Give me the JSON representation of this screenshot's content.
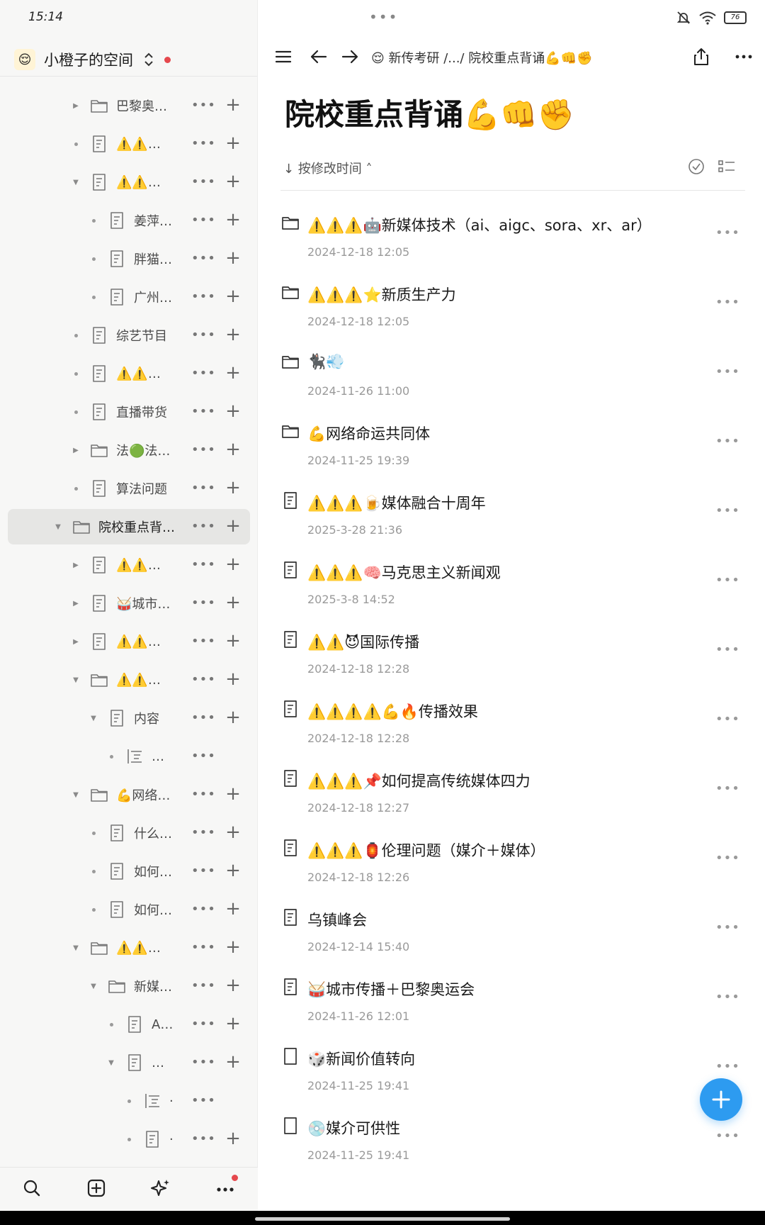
{
  "status": {
    "time": "15:14",
    "battery": "76"
  },
  "sidebar": {
    "space_emoji": "😌",
    "space_name": "小橙子的空间",
    "tree": [
      {
        "label": "巴黎奥…",
        "kind": "folder",
        "depth": 0,
        "toggle": "collapsed"
      },
      {
        "label": "⚠️⚠️…",
        "kind": "doc",
        "depth": 0,
        "toggle": "bullet"
      },
      {
        "label": "⚠️⚠️…",
        "kind": "doc",
        "depth": 0,
        "toggle": "expanded"
      },
      {
        "label": "姜萍…",
        "kind": "doc",
        "depth": 1,
        "toggle": "bullet"
      },
      {
        "label": "胖猫…",
        "kind": "doc",
        "depth": 1,
        "toggle": "bullet"
      },
      {
        "label": "广州…",
        "kind": "doc",
        "depth": 1,
        "toggle": "bullet"
      },
      {
        "label": "综艺节目",
        "kind": "doc",
        "depth": 0,
        "toggle": "bullet"
      },
      {
        "label": "⚠️⚠️…",
        "kind": "doc",
        "depth": 0,
        "toggle": "bullet"
      },
      {
        "label": "直播带货",
        "kind": "doc",
        "depth": 0,
        "toggle": "bullet"
      },
      {
        "label": "法🟢法…",
        "kind": "folder",
        "depth": 0,
        "toggle": "collapsed"
      },
      {
        "label": "算法问题",
        "kind": "doc",
        "depth": 0,
        "toggle": "bullet"
      },
      {
        "label": "院校重点背…",
        "kind": "folder",
        "depth": -1,
        "toggle": "expanded",
        "selected": true
      },
      {
        "label": "⚠️⚠️…",
        "kind": "doc",
        "depth": 0,
        "toggle": "collapsed"
      },
      {
        "label": "🥁城市…",
        "kind": "doc",
        "depth": 0,
        "toggle": "collapsed"
      },
      {
        "label": "⚠️⚠️…",
        "kind": "doc",
        "depth": 0,
        "toggle": "collapsed"
      },
      {
        "label": "⚠️⚠️…",
        "kind": "folder",
        "depth": 0,
        "toggle": "expanded"
      },
      {
        "label": "内容",
        "kind": "doc",
        "depth": 1,
        "toggle": "expanded"
      },
      {
        "label": "…",
        "kind": "outline",
        "depth": 2,
        "toggle": "bullet",
        "no_plus": true
      },
      {
        "label": "💪网络…",
        "kind": "folder",
        "depth": 0,
        "toggle": "expanded"
      },
      {
        "label": "什么…",
        "kind": "doc",
        "depth": 1,
        "toggle": "bullet"
      },
      {
        "label": "如何…",
        "kind": "doc",
        "depth": 1,
        "toggle": "bullet"
      },
      {
        "label": "如何…",
        "kind": "doc",
        "depth": 1,
        "toggle": "bullet"
      },
      {
        "label": "⚠️⚠️…",
        "kind": "folder",
        "depth": 0,
        "toggle": "expanded"
      },
      {
        "label": "新媒…",
        "kind": "folder",
        "depth": 1,
        "toggle": "expanded"
      },
      {
        "label": "A…",
        "kind": "doc",
        "depth": 2,
        "toggle": "bullet"
      },
      {
        "label": "…",
        "kind": "doc",
        "depth": 2,
        "toggle": "expanded"
      },
      {
        "label": "·",
        "kind": "outline",
        "depth": 3,
        "toggle": "bullet",
        "no_plus": true
      },
      {
        "label": "·",
        "kind": "doc",
        "depth": 3,
        "toggle": "bullet"
      }
    ],
    "bottom_icons": [
      "search-icon",
      "new-page-icon",
      "ai-sparkle-icon",
      "more-icon"
    ]
  },
  "header": {
    "breadcrumb": "😌 新传考研 /.../ 院校重点背诵💪👊✊"
  },
  "page": {
    "title": "院校重点背诵💪👊✊",
    "sort_label": "↓ 按修改时间 ˄",
    "items": [
      {
        "title": "⚠️⚠️⚠️🤖新媒体技术（ai、aigc、sora、xr、ar）",
        "time": "2024-12-18 12:05",
        "kind": "folder"
      },
      {
        "title": "⚠️⚠️⚠️⭐新质生产力",
        "time": "2024-12-18 12:05",
        "kind": "folder"
      },
      {
        "title": "🐈‍⬛💨",
        "time": "2024-11-26 11:00",
        "kind": "folder"
      },
      {
        "title": "💪网络命运共同体",
        "time": "2024-11-25 19:39",
        "kind": "folder"
      },
      {
        "title": "⚠️⚠️⚠️🍺媒体融合十周年",
        "time": "2025-3-28 21:36",
        "kind": "doc"
      },
      {
        "title": "⚠️⚠️⚠️🧠马克思主义新闻观",
        "time": "2025-3-8 14:52",
        "kind": "doc"
      },
      {
        "title": "⚠️⚠️😈国际传播",
        "time": "2024-12-18 12:28",
        "kind": "doc"
      },
      {
        "title": "⚠️⚠️⚠️⚠️💪🔥传播效果",
        "time": "2024-12-18 12:28",
        "kind": "doc"
      },
      {
        "title": "⚠️⚠️⚠️📌如何提高传统媒体四力",
        "time": "2024-12-18 12:27",
        "kind": "doc"
      },
      {
        "title": "⚠️⚠️⚠️🏮伦理问题（媒介＋媒体）",
        "time": "2024-12-18 12:26",
        "kind": "doc"
      },
      {
        "title": "乌镇峰会",
        "time": "2024-12-14 15:40",
        "kind": "doc"
      },
      {
        "title": "🥁城市传播＋巴黎奥运会",
        "time": "2024-11-26 12:01",
        "kind": "doc"
      },
      {
        "title": "🎲新闻价值转向",
        "time": "2024-11-25 19:41",
        "kind": "blank"
      },
      {
        "title": "💿媒介可供性",
        "time": "2024-11-25 19:41",
        "kind": "blank"
      }
    ]
  },
  "colors": {
    "accent": "#2d9bf0",
    "badge": "#e5484d",
    "sidebar_bg": "#f7f7f6"
  }
}
